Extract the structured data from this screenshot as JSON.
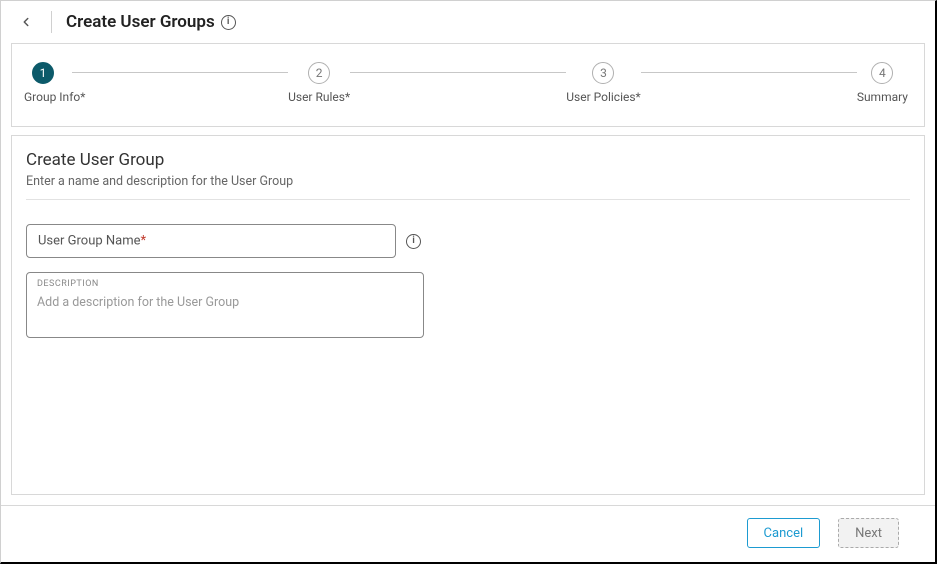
{
  "header": {
    "title": "Create User Groups"
  },
  "stepper": {
    "steps": [
      {
        "num": "1",
        "label": "Group Info*",
        "active": true
      },
      {
        "num": "2",
        "label": "User Rules*",
        "active": false
      },
      {
        "num": "3",
        "label": "User Policies*",
        "active": false
      },
      {
        "num": "4",
        "label": "Summary",
        "active": false
      }
    ]
  },
  "form": {
    "title": "Create User Group",
    "subtitle": "Enter a name and description for the User Group",
    "name_placeholder_base": "User Group Name",
    "name_required_mark": "*",
    "desc_label": "DESCRIPTION",
    "desc_placeholder": "Add a description for the User Group"
  },
  "footer": {
    "cancel": "Cancel",
    "next": "Next"
  }
}
